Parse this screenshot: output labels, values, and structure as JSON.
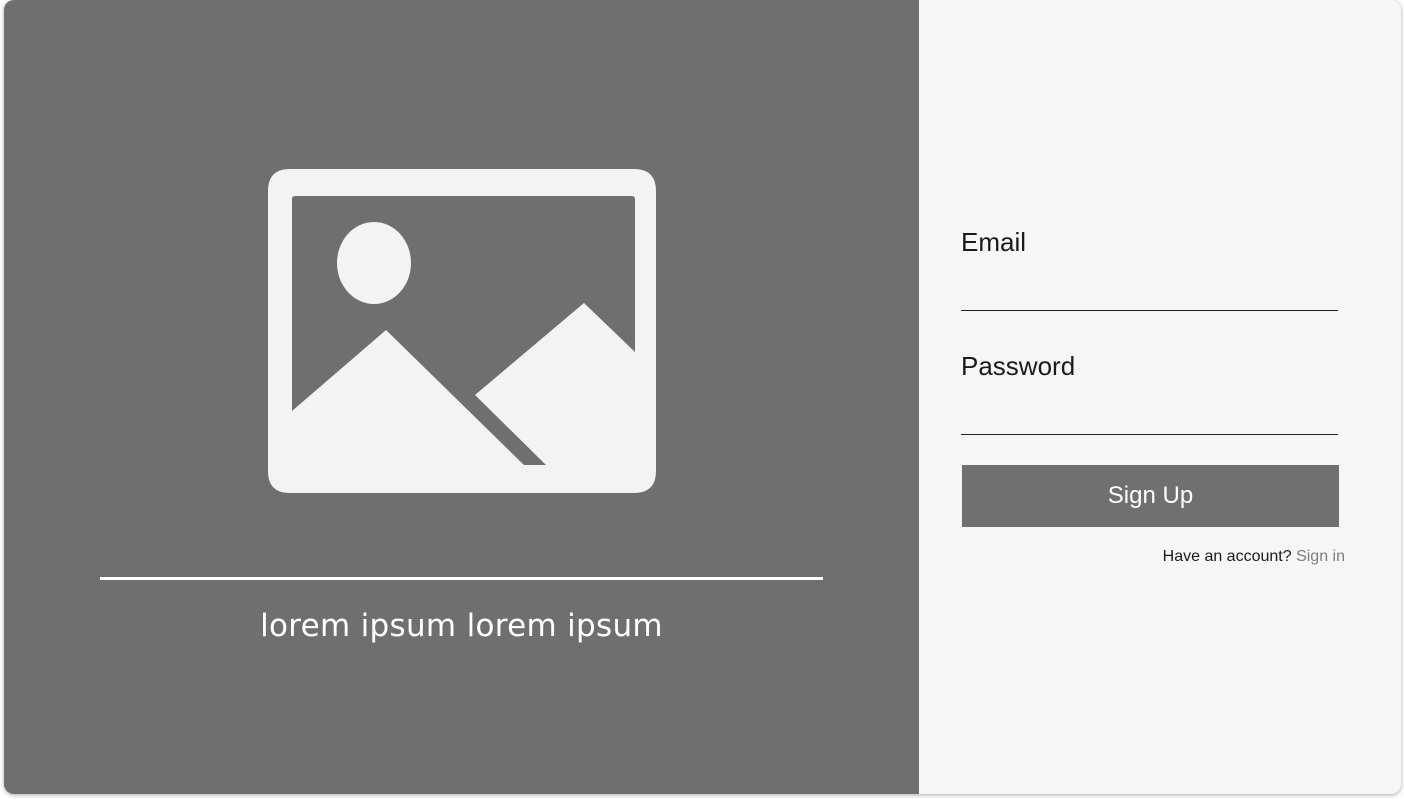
{
  "hero": {
    "image_icon": "image-placeholder-icon",
    "caption": "lorem ipsum lorem ipsum"
  },
  "form": {
    "email_label": "Email",
    "email_value": "",
    "password_label": "Password",
    "password_value": "",
    "submit_label": "Sign Up",
    "account_prompt": "Have an account?",
    "signin_link": "Sign in"
  },
  "colors": {
    "panel_dark": "#6f6f6f",
    "panel_light": "#f6f6f6",
    "button": "#707070",
    "link": "#7d7d7d"
  }
}
